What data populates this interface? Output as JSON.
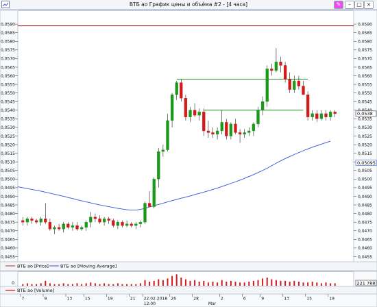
{
  "window": {
    "title": "ВТБ ао График цены и объёма #2 - [4 часа]"
  },
  "chart_data": {
    "type": "candlestick",
    "y_axis": {
      "ylim": [
        0.0452,
        0.0598
      ],
      "ticks": [
        "0,0590",
        "0,0585",
        "0,0580",
        "0,0575",
        "0,0570",
        "0,0565",
        "0,0560",
        "0,0555",
        "0,0550",
        "0,0545",
        "0,0540",
        "0,0535",
        "0,0530",
        "0,0525",
        "0,0520",
        "0,0515",
        "0,0510",
        "0,0505",
        "0,0500",
        "0,0495",
        "0,0490",
        "0,0485",
        "0,0480",
        "0,0475",
        "0,0470",
        "0,0465",
        "0,0460",
        "0,0455"
      ],
      "tick_values": [
        0.059,
        0.0585,
        0.058,
        0.0575,
        0.057,
        0.0565,
        0.056,
        0.0555,
        0.055,
        0.0545,
        0.054,
        0.0535,
        0.053,
        0.0525,
        0.052,
        0.0515,
        0.051,
        0.0505,
        0.05,
        0.0495,
        0.049,
        0.0485,
        0.048,
        0.0475,
        0.047,
        0.0465,
        0.046,
        0.0455
      ]
    },
    "price_label": "0,0538",
    "ma_label": "0,05095",
    "ma_label_value": 0.05095,
    "resistance_level": 0.0589,
    "levels": [
      {
        "value": 0.0558,
        "from": 34,
        "to": 63
      },
      {
        "value": 0.054,
        "from": 40,
        "to": 62
      }
    ],
    "x_ticks": [
      {
        "label": "7",
        "index": 0
      },
      {
        "label": "9",
        "index": 5
      },
      {
        "label": "13",
        "index": 10
      },
      {
        "label": "15",
        "index": 14
      },
      {
        "label": "19",
        "index": 19
      },
      {
        "label": "21",
        "index": 24
      },
      {
        "label": "22.02.2018",
        "index": 27
      },
      {
        "label": "26",
        "index": 33
      },
      {
        "label": "28",
        "index": 38
      },
      {
        "label": "2",
        "index": 44
      },
      {
        "label": "6",
        "index": 49
      },
      {
        "label": "9",
        "index": 53
      },
      {
        "label": "13",
        "index": 58
      },
      {
        "label": "15",
        "index": 63
      },
      {
        "label": "19",
        "index": 68
      }
    ],
    "date_label_bottom": "12:00",
    "month_label": "Mar",
    "month_label_index": 41,
    "candles": [
      {
        "o": 0.0476,
        "h": 0.0478,
        "l": 0.0473,
        "c": 0.0475
      },
      {
        "o": 0.0475,
        "h": 0.0478,
        "l": 0.0473,
        "c": 0.0477
      },
      {
        "o": 0.0477,
        "h": 0.0478,
        "l": 0.0474,
        "c": 0.0476
      },
      {
        "o": 0.0476,
        "h": 0.0477,
        "l": 0.0474,
        "c": 0.0475
      },
      {
        "o": 0.0475,
        "h": 0.0478,
        "l": 0.0473,
        "c": 0.0477
      },
      {
        "o": 0.0477,
        "h": 0.0486,
        "l": 0.0474,
        "c": 0.0475
      },
      {
        "o": 0.0475,
        "h": 0.0477,
        "l": 0.047,
        "c": 0.0471
      },
      {
        "o": 0.0471,
        "h": 0.0473,
        "l": 0.0468,
        "c": 0.0472
      },
      {
        "o": 0.0472,
        "h": 0.0474,
        "l": 0.047,
        "c": 0.0471
      },
      {
        "o": 0.0471,
        "h": 0.0475,
        "l": 0.0469,
        "c": 0.0474
      },
      {
        "o": 0.0474,
        "h": 0.0475,
        "l": 0.0471,
        "c": 0.0472
      },
      {
        "o": 0.0472,
        "h": 0.0475,
        "l": 0.047,
        "c": 0.0473
      },
      {
        "o": 0.0473,
        "h": 0.0475,
        "l": 0.047,
        "c": 0.0471
      },
      {
        "o": 0.0471,
        "h": 0.0473,
        "l": 0.047,
        "c": 0.0472
      },
      {
        "o": 0.0472,
        "h": 0.0476,
        "l": 0.047,
        "c": 0.0475
      },
      {
        "o": 0.0475,
        "h": 0.0481,
        "l": 0.0472,
        "c": 0.0478
      },
      {
        "o": 0.0478,
        "h": 0.048,
        "l": 0.0475,
        "c": 0.0477
      },
      {
        "o": 0.0477,
        "h": 0.0479,
        "l": 0.0474,
        "c": 0.0475
      },
      {
        "o": 0.0475,
        "h": 0.0478,
        "l": 0.0473,
        "c": 0.0477
      },
      {
        "o": 0.0477,
        "h": 0.0478,
        "l": 0.0474,
        "c": 0.0476
      },
      {
        "o": 0.0476,
        "h": 0.0477,
        "l": 0.0472,
        "c": 0.0473
      },
      {
        "o": 0.0473,
        "h": 0.0476,
        "l": 0.0471,
        "c": 0.0475
      },
      {
        "o": 0.0475,
        "h": 0.0476,
        "l": 0.0472,
        "c": 0.0473
      },
      {
        "o": 0.0473,
        "h": 0.0476,
        "l": 0.0472,
        "c": 0.0474
      },
      {
        "o": 0.0474,
        "h": 0.0475,
        "l": 0.0472,
        "c": 0.0473
      },
      {
        "o": 0.0473,
        "h": 0.0475,
        "l": 0.0471,
        "c": 0.0474
      },
      {
        "o": 0.0474,
        "h": 0.0476,
        "l": 0.0472,
        "c": 0.0475
      },
      {
        "o": 0.0475,
        "h": 0.0487,
        "l": 0.0474,
        "c": 0.0486
      },
      {
        "o": 0.0486,
        "h": 0.0493,
        "l": 0.0485,
        "c": 0.0484
      },
      {
        "o": 0.0484,
        "h": 0.0501,
        "l": 0.0483,
        "c": 0.05
      },
      {
        "o": 0.05,
        "h": 0.0518,
        "l": 0.0495,
        "c": 0.0516
      },
      {
        "o": 0.0516,
        "h": 0.052,
        "l": 0.0513,
        "c": 0.0517
      },
      {
        "o": 0.0517,
        "h": 0.0538,
        "l": 0.0516,
        "c": 0.0534
      },
      {
        "o": 0.0534,
        "h": 0.055,
        "l": 0.053,
        "c": 0.0549
      },
      {
        "o": 0.0549,
        "h": 0.0557,
        "l": 0.0546,
        "c": 0.0556
      },
      {
        "o": 0.0556,
        "h": 0.0558,
        "l": 0.0545,
        "c": 0.0547
      },
      {
        "o": 0.0547,
        "h": 0.0549,
        "l": 0.0534,
        "c": 0.0536
      },
      {
        "o": 0.0536,
        "h": 0.0542,
        "l": 0.0533,
        "c": 0.054
      },
      {
        "o": 0.054,
        "h": 0.0544,
        "l": 0.0536,
        "c": 0.0537
      },
      {
        "o": 0.0537,
        "h": 0.0541,
        "l": 0.0534,
        "c": 0.0539
      },
      {
        "o": 0.0539,
        "h": 0.0541,
        "l": 0.0525,
        "c": 0.0528
      },
      {
        "o": 0.0528,
        "h": 0.0534,
        "l": 0.0524,
        "c": 0.0527
      },
      {
        "o": 0.0527,
        "h": 0.053,
        "l": 0.0524,
        "c": 0.0526
      },
      {
        "o": 0.0526,
        "h": 0.053,
        "l": 0.0523,
        "c": 0.0528
      },
      {
        "o": 0.0528,
        "h": 0.054,
        "l": 0.0526,
        "c": 0.0533
      },
      {
        "o": 0.0533,
        "h": 0.0535,
        "l": 0.0523,
        "c": 0.0525
      },
      {
        "o": 0.0525,
        "h": 0.0533,
        "l": 0.0523,
        "c": 0.0532
      },
      {
        "o": 0.0532,
        "h": 0.0535,
        "l": 0.0526,
        "c": 0.0527
      },
      {
        "o": 0.0527,
        "h": 0.0529,
        "l": 0.0521,
        "c": 0.0526
      },
      {
        "o": 0.0526,
        "h": 0.0529,
        "l": 0.0524,
        "c": 0.0527
      },
      {
        "o": 0.0527,
        "h": 0.053,
        "l": 0.0525,
        "c": 0.0528
      },
      {
        "o": 0.0528,
        "h": 0.0533,
        "l": 0.0525,
        "c": 0.0532
      },
      {
        "o": 0.0532,
        "h": 0.0542,
        "l": 0.053,
        "c": 0.054
      },
      {
        "o": 0.054,
        "h": 0.0548,
        "l": 0.0537,
        "c": 0.0545
      },
      {
        "o": 0.0545,
        "h": 0.0566,
        "l": 0.0542,
        "c": 0.0564
      },
      {
        "o": 0.0564,
        "h": 0.0567,
        "l": 0.056,
        "c": 0.0563
      },
      {
        "o": 0.0563,
        "h": 0.0576,
        "l": 0.0562,
        "c": 0.0568
      },
      {
        "o": 0.0568,
        "h": 0.0571,
        "l": 0.0562,
        "c": 0.0566
      },
      {
        "o": 0.0566,
        "h": 0.0568,
        "l": 0.0556,
        "c": 0.0558
      },
      {
        "o": 0.0558,
        "h": 0.0562,
        "l": 0.055,
        "c": 0.0552
      },
      {
        "o": 0.0552,
        "h": 0.056,
        "l": 0.055,
        "c": 0.0557
      },
      {
        "o": 0.0557,
        "h": 0.056,
        "l": 0.0552,
        "c": 0.0554
      },
      {
        "o": 0.0554,
        "h": 0.0557,
        "l": 0.055,
        "c": 0.0549
      },
      {
        "o": 0.0549,
        "h": 0.0551,
        "l": 0.0534,
        "c": 0.0536
      },
      {
        "o": 0.0536,
        "h": 0.054,
        "l": 0.0534,
        "c": 0.0538
      },
      {
        "o": 0.0538,
        "h": 0.054,
        "l": 0.0533,
        "c": 0.0535
      },
      {
        "o": 0.0535,
        "h": 0.054,
        "l": 0.0534,
        "c": 0.0538
      },
      {
        "o": 0.0538,
        "h": 0.054,
        "l": 0.0534,
        "c": 0.0536
      },
      {
        "o": 0.0536,
        "h": 0.054,
        "l": 0.0534,
        "c": 0.0539
      },
      {
        "o": 0.0539,
        "h": 0.054,
        "l": 0.0536,
        "c": 0.0538
      }
    ],
    "moving_average": [
      0.04955,
      0.0495,
      0.04945,
      0.0494,
      0.04935,
      0.0493,
      0.04924,
      0.04918,
      0.04912,
      0.04906,
      0.049,
      0.04893,
      0.04887,
      0.0488,
      0.04874,
      0.04868,
      0.04862,
      0.04856,
      0.0485,
      0.04845,
      0.0484,
      0.04835,
      0.0483,
      0.04826,
      0.04822,
      0.0482,
      0.0482,
      0.04824,
      0.0483,
      0.04838,
      0.04846,
      0.04853,
      0.0486,
      0.04868,
      0.04875,
      0.04882,
      0.04889,
      0.04895,
      0.04902,
      0.0491,
      0.04917,
      0.04924,
      0.04932,
      0.0494,
      0.04948,
      0.04957,
      0.04966,
      0.04975,
      0.04984,
      0.04994,
      0.05004,
      0.05015,
      0.05026,
      0.05038,
      0.0505,
      0.05063,
      0.05078,
      0.05092,
      0.05106,
      0.05119,
      0.05131,
      0.05143,
      0.05154,
      0.05165,
      0.05175,
      0.05185,
      0.05194,
      0.05203,
      0.05212,
      0.0522
    ],
    "legend": [
      {
        "label": "ВТБ ао [Price]",
        "color": "#9b3434"
      },
      {
        "label": "ВТБ ао [Moving Average]",
        "color": "#2f54d6"
      }
    ],
    "volume": {
      "label": "ВТБ ао [Volume]",
      "value_label": "221 788",
      "ticks": [
        "0"
      ],
      "values": [
        2,
        3,
        2,
        2,
        3,
        6,
        3,
        2,
        2,
        3,
        2,
        2,
        3,
        2,
        3,
        4,
        3,
        2,
        3,
        2,
        2,
        3,
        2,
        2,
        2,
        2,
        3,
        7,
        5,
        6,
        8,
        7,
        9,
        12,
        14,
        10,
        8,
        6,
        7,
        5,
        6,
        4,
        5,
        4,
        7,
        5,
        6,
        5,
        4,
        4,
        5,
        6,
        7,
        9,
        10,
        8,
        7,
        6,
        6,
        5,
        6,
        5,
        4,
        4,
        5,
        4,
        3,
        4,
        3,
        3
      ],
      "vmax": 16
    }
  }
}
